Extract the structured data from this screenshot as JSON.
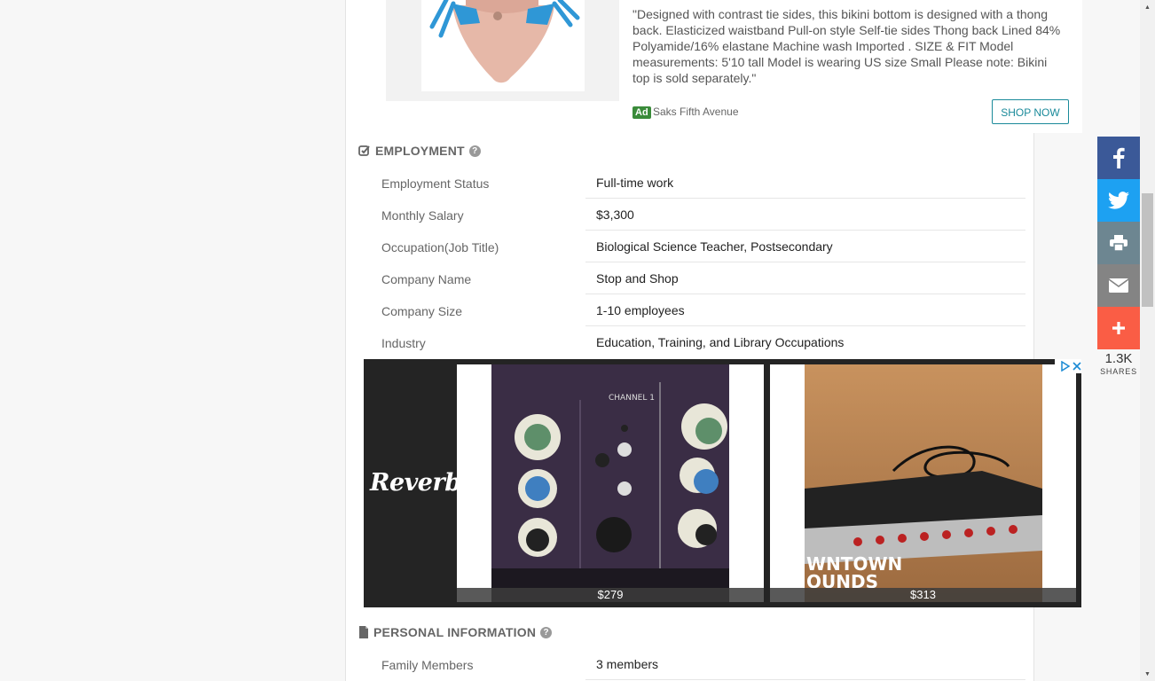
{
  "ad_top": {
    "description": "\"Designed with contrast tie sides, this bikini bottom is designed with a thong back. Elasticized waistband Pull-on style Self-tie sides Thong back Lined 84% Polyamide/16% elastane Machine wash Imported . SIZE & FIT Model measurements: 5'10 tall Model is wearing US size Small Please note: Bikini top is sold separately.\"",
    "badge": "Ad",
    "sponsor": "Saks Fifth Avenue",
    "button": "SHOP NOW",
    "image": "bikini-bottom-image"
  },
  "employment": {
    "title": "EMPLOYMENT",
    "icon": "checkbox-edit-icon",
    "rows": [
      {
        "label": "Employment Status",
        "value": "Full-time work"
      },
      {
        "label": "Monthly Salary",
        "value": "$3,300"
      },
      {
        "label": "Occupation(Job Title)",
        "value": "Biological Science Teacher, Postsecondary"
      },
      {
        "label": "Company Name",
        "value": "Stop and Shop"
      },
      {
        "label": "Company Size",
        "value": "1-10 employees"
      },
      {
        "label": "Industry",
        "value": "Education, Training, and Library Occupations"
      }
    ]
  },
  "ad_reverb": {
    "brand": "Reverb",
    "products": [
      {
        "price": "$279",
        "image": "audio-equalizer-knobs-image"
      },
      {
        "price": "$313",
        "image": "rack-mount-unit-image"
      }
    ]
  },
  "personal": {
    "title": "PERSONAL INFORMATION",
    "icon": "file-icon",
    "rows": [
      {
        "label": "Family Members",
        "value": "3 members"
      }
    ]
  },
  "share": {
    "count": "1.3K",
    "label": "SHARES",
    "buttons": [
      {
        "name": "facebook",
        "color": "#3b5998"
      },
      {
        "name": "twitter",
        "color": "#1da1f2"
      },
      {
        "name": "print",
        "color": "#6d8691"
      },
      {
        "name": "email",
        "color": "#848484"
      },
      {
        "name": "more",
        "color": "#fa5d45"
      }
    ]
  }
}
